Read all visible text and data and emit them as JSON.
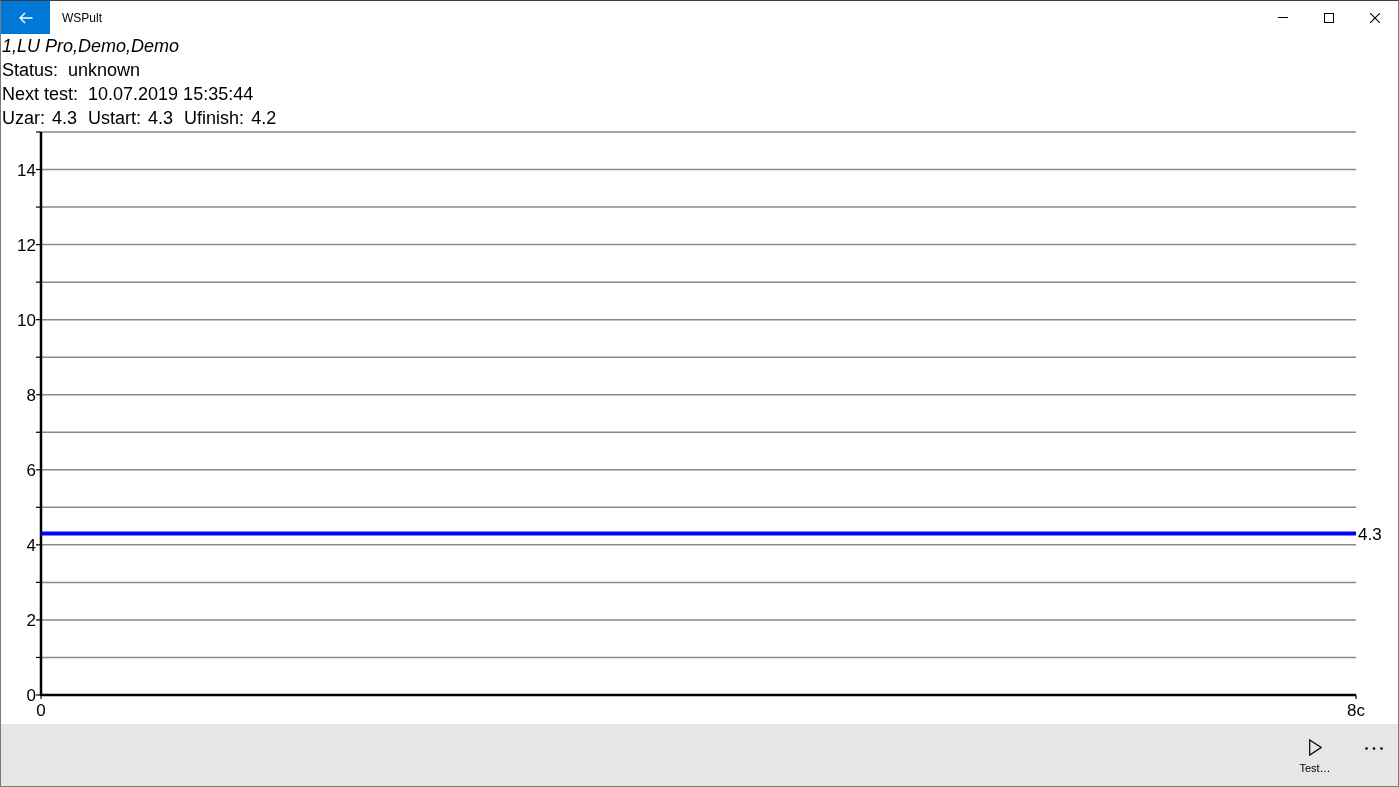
{
  "window": {
    "title": "WSPult"
  },
  "device": {
    "name": "1,LU Pro,Demo,Demo"
  },
  "info": [
    {
      "label": "Status:",
      "value": "unknown"
    },
    {
      "label": "Next test:",
      "value": "10.07.2019 15:35:44"
    }
  ],
  "voltages": [
    {
      "label": "Uzar:",
      "value": "4.3"
    },
    {
      "label": "Ustart:",
      "value": "4.3"
    },
    {
      "label": "Ufinish:",
      "value": "4.2"
    }
  ],
  "chart": {
    "chart_data": [
      {
        "type": "line",
        "x": [
          0,
          8
        ],
        "xlim": [
          0,
          8
        ],
        "ylim": [
          0,
          15
        ],
        "xticks": [
          0,
          {
            "value": 8,
            "label": "8c"
          }
        ],
        "yticks": [
          0,
          2,
          4,
          6,
          8,
          10,
          12,
          14
        ],
        "grid": true,
        "series": [
          {
            "color": "#0000ff",
            "values": [
              4.3,
              4.3
            ]
          }
        ],
        "annotations": [
          "4.3"
        ]
      }
    ]
  },
  "command_bar": {
    "buttons": [
      {
        "kind": "play",
        "label": "Test…"
      },
      {
        "kind": "more"
      }
    ]
  }
}
